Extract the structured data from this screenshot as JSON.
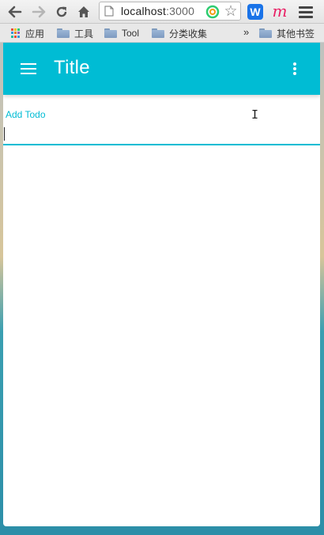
{
  "browser": {
    "url_host": "localhost",
    "url_port": ":3000",
    "icons": {
      "back": "arrow-left-icon",
      "forward": "arrow-right-icon",
      "reload": "reload-icon",
      "home": "home-icon",
      "star": "star-icon"
    },
    "ext_w_label": "W",
    "ext_m_label": "m",
    "bookmarks": [
      {
        "label": "应用",
        "icon": "apps-icon"
      },
      {
        "label": "工具",
        "icon": "folder-icon"
      },
      {
        "label": "Tool",
        "icon": "folder-icon"
      },
      {
        "label": "分类收集",
        "icon": "folder-icon"
      }
    ],
    "bookmarks_more": "»",
    "other_bookmarks": "其他书签"
  },
  "app": {
    "title": "Title",
    "accent_color": "#00bcd4",
    "todo": {
      "label": "Add Todo",
      "value": ""
    }
  }
}
